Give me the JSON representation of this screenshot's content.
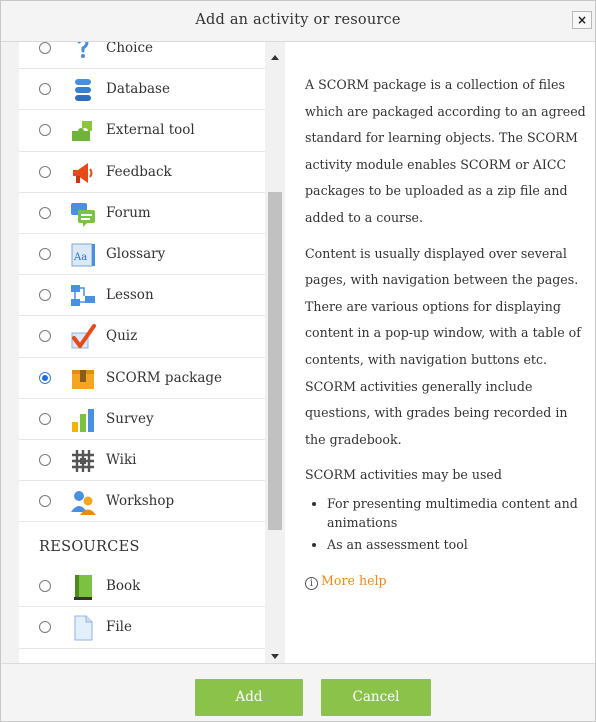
{
  "dialog": {
    "title": "Add an activity or resource",
    "close_label": "×"
  },
  "activities": [
    {
      "label": "Choice",
      "icon": "choice-icon",
      "selected": false
    },
    {
      "label": "Database",
      "icon": "database-icon",
      "selected": false
    },
    {
      "label": "External tool",
      "icon": "puzzle-icon",
      "selected": false
    },
    {
      "label": "Feedback",
      "icon": "megaphone-icon",
      "selected": false
    },
    {
      "label": "Forum",
      "icon": "forum-icon",
      "selected": false
    },
    {
      "label": "Glossary",
      "icon": "glossary-icon",
      "selected": false
    },
    {
      "label": "Lesson",
      "icon": "lesson-icon",
      "selected": false
    },
    {
      "label": "Quiz",
      "icon": "quiz-check-icon",
      "selected": false
    },
    {
      "label": "SCORM package",
      "icon": "scorm-package-icon",
      "selected": true
    },
    {
      "label": "Survey",
      "icon": "survey-chart-icon",
      "selected": false
    },
    {
      "label": "Wiki",
      "icon": "wiki-icon",
      "selected": false
    },
    {
      "label": "Workshop",
      "icon": "workshop-icon",
      "selected": false
    }
  ],
  "resources_heading": "RESOURCES",
  "resources": [
    {
      "label": "Book",
      "icon": "book-icon",
      "selected": false
    },
    {
      "label": "File",
      "icon": "file-icon",
      "selected": false
    }
  ],
  "description": {
    "para1": "A SCORM package is a collection of files which are packaged according to an agreed standard for learning objects. The SCORM activity module enables SCORM or AICC packages to be uploaded as a zip file and added to a course.",
    "para2": "Content is usually displayed over several pages, with navigation between the pages. There are various options for displaying content in a pop-up window, with a table of contents, with navigation buttons etc. SCORM activities generally include questions, with grades being recorded in the gradebook.",
    "para3": "SCORM activities may be used",
    "bullets": [
      "For presenting multimedia content and animations",
      "As an assessment tool"
    ],
    "help_icon_glyph": "i",
    "more_help": "More help"
  },
  "footer": {
    "add_label": "Add",
    "cancel_label": "Cancel"
  },
  "colors": {
    "button_green": "#8bc34a",
    "help_link": "#f0891a",
    "radio_selected": "#1b6ce0"
  }
}
